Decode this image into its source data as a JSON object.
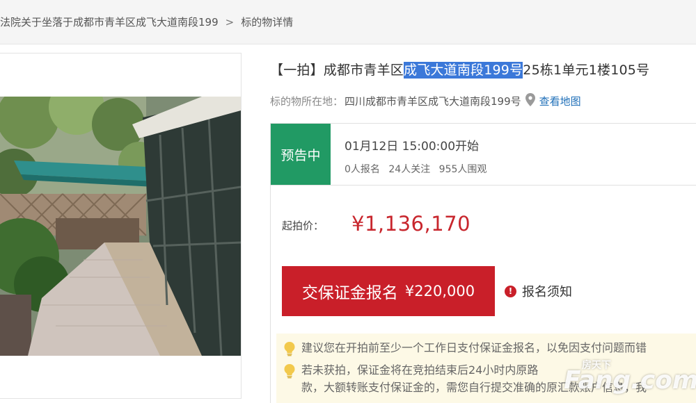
{
  "breadcrumb": {
    "items": [
      "法院关于坐落于成都市青羊区成飞大道南段199",
      "标的物详情"
    ],
    "separator": ">"
  },
  "listing": {
    "title_prefix": "【一拍】成都市青羊区",
    "title_highlight": "成飞大道南段199号",
    "title_suffix": "25栋1单元1楼105号",
    "location_label": "标的物所在地：",
    "location_value": "四川成都市青羊区成飞大道南段199号",
    "map_link": "查看地图"
  },
  "status": {
    "badge": "预告中",
    "start_time": "01月12日 15:00:00开始",
    "signups": "0人报名",
    "followers": "24人关注",
    "viewers": "955人围观",
    "badge_color": "#219a64"
  },
  "price": {
    "label": "起拍价：",
    "value": "¥1,136,170",
    "color": "#c8262d"
  },
  "deposit": {
    "button_label": "交保证金报名",
    "amount": "¥220,000",
    "notice": "报名须知"
  },
  "tips": [
    "建议您在开拍前至少一个工作日支付保证金报名，以免因支付问题而错",
    "若未获拍，保证金将在竞拍结束后24小时内原路",
    "款，大额转账支付保证金的，需您自行提交准确的原汇款账户信息，我"
  ],
  "watermark": {
    "brand": "房天下",
    "domain": "Fang.com"
  },
  "icons": {
    "pin": "map-pin-icon",
    "alert": "alert-icon",
    "bulb": "lightbulb-icon"
  }
}
